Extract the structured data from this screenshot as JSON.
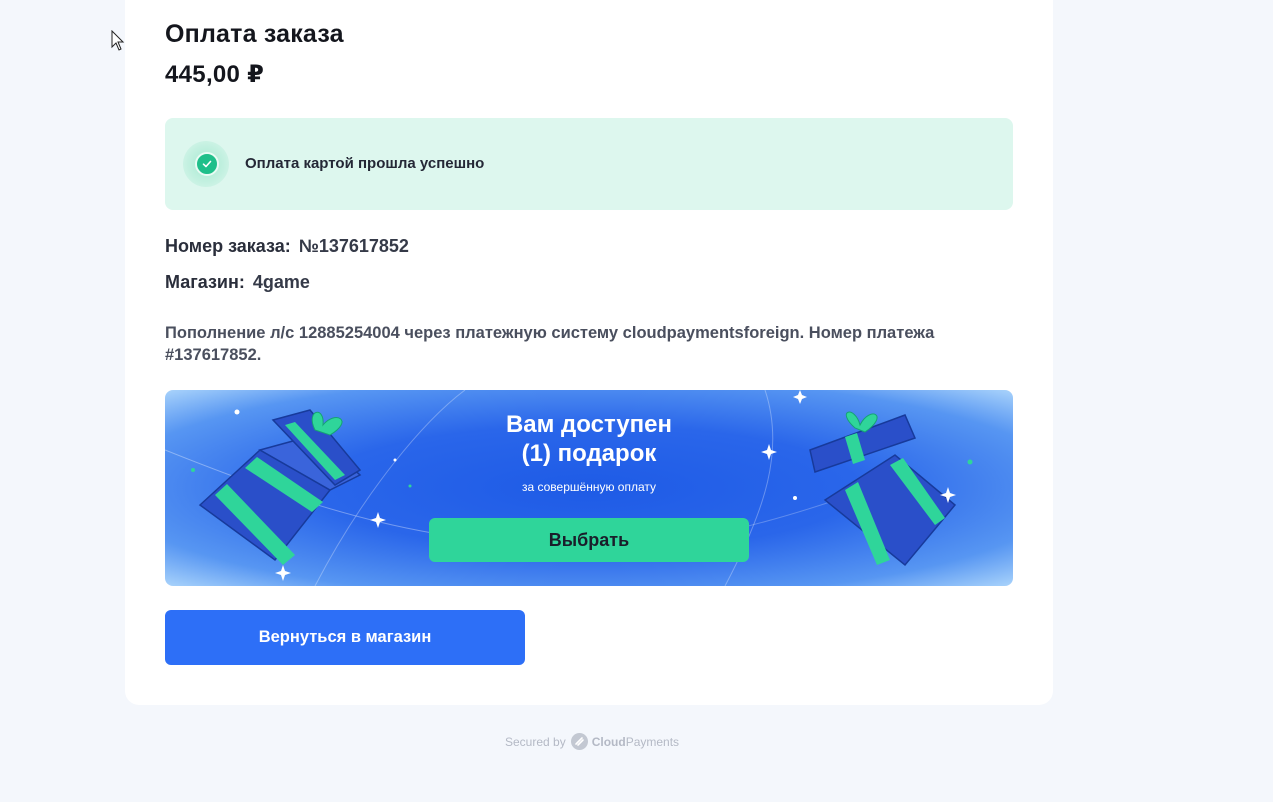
{
  "order": {
    "title": "Оплата заказа",
    "amount": "445,00 ₽"
  },
  "status": {
    "message": "Оплата картой прошла успешно",
    "icon": "check-circle-icon",
    "color": "#1fbf8a"
  },
  "details": {
    "order_number_label": "Номер заказа:",
    "order_number_value": "№137617852",
    "shop_label": "Магазин:",
    "shop_value": "4game"
  },
  "description": "Пополнение л/с 12885254004 через платежную систему cloudpaymentsforeign. Номер платежа #137617852.",
  "gift_banner": {
    "title_line1": "Вам доступен",
    "title_line2": "(1) подарок",
    "subtitle": "за совершённую оплату",
    "button_label": "Выбрать",
    "button_color": "#2fd59a"
  },
  "actions": {
    "return_label": "Вернуться в магазин",
    "return_color": "#2d6ff7"
  },
  "footer": {
    "secured_by": "Secured by",
    "brand_bold": "Cloud",
    "brand_rest": "Payments"
  }
}
